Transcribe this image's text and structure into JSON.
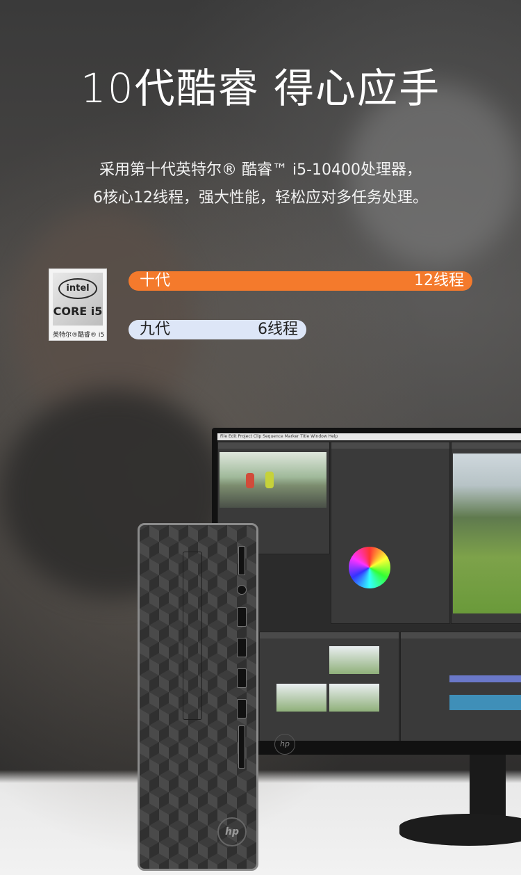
{
  "headline": "10代酷睿  得心应手",
  "subtitle_line1": "采用第十代英特尔® 酷睿™ i5-10400处理器，",
  "subtitle_line2": "6核心12线程，强大性能，轻松应对多任务处理。",
  "badge": {
    "brand": "intel",
    "core": "CORE i5",
    "footer": "英特尔®酷睿® i5"
  },
  "comparison": [
    {
      "label": "十代",
      "value_text": "12线程",
      "threads": 12,
      "color": "#f47a2c"
    },
    {
      "label": "九代",
      "value_text": "6线程",
      "threads": 6,
      "color": "#dde6f7"
    }
  ],
  "monitor_menu": "File  Edit  Project  Clip  Sequence  Marker  Title  Window  Help",
  "monitor_logo": "hp",
  "tower_logo": "hp"
}
